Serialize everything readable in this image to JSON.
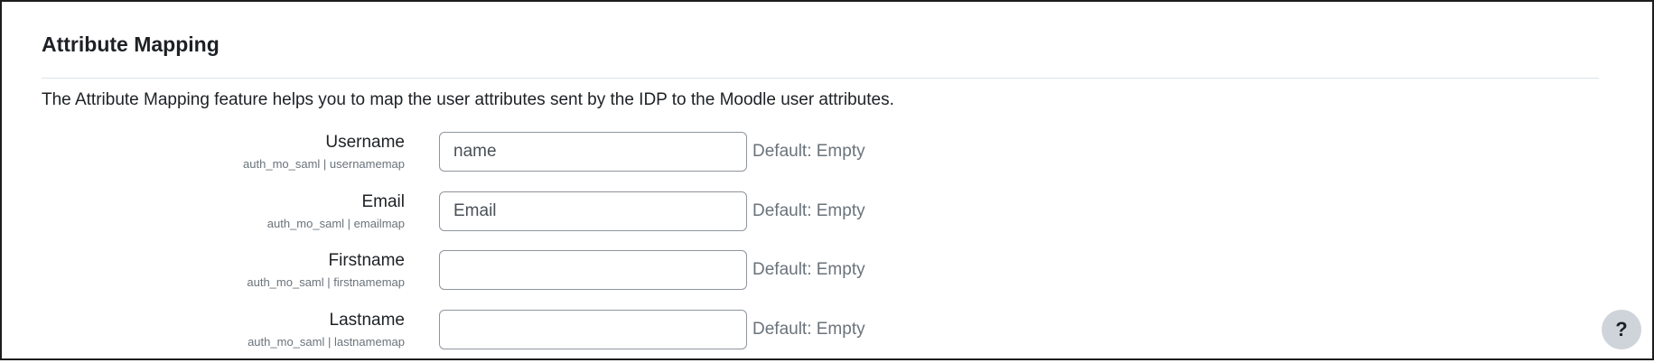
{
  "section": {
    "title": "Attribute Mapping",
    "description": "The Attribute Mapping feature helps you to map the user attributes sent by the IDP to the Moodle user attributes."
  },
  "settings": [
    {
      "label": "Username",
      "id": "auth_mo_saml | usernamemap",
      "value": "name",
      "placeholder": "",
      "default": "Default: Empty"
    },
    {
      "label": "Email",
      "id": "auth_mo_saml | emailmap",
      "value": "Email",
      "placeholder": "",
      "default": "Default: Empty"
    },
    {
      "label": "Firstname",
      "id": "auth_mo_saml | firstnamemap",
      "value": "",
      "placeholder": "",
      "default": "Default: Empty"
    },
    {
      "label": "Lastname",
      "id": "auth_mo_saml | lastnamemap",
      "value": "",
      "placeholder": "",
      "default": "Default: Empty"
    }
  ],
  "help": {
    "label": "?",
    "icon": "question-mark-icon"
  }
}
